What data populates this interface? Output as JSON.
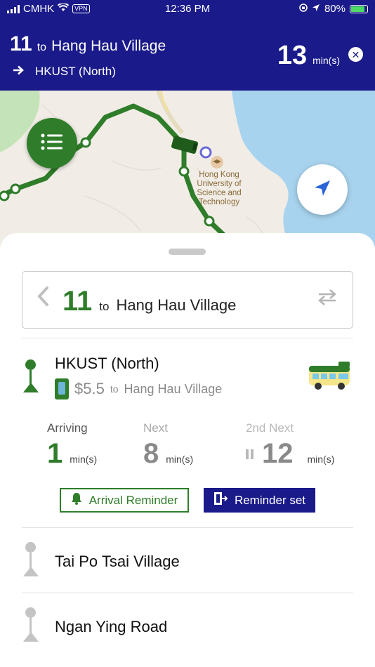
{
  "status_bar": {
    "carrier": "CMHK",
    "vpn": "VPN",
    "time": "12:36 PM",
    "battery": "80%"
  },
  "header": {
    "route_number": "11",
    "to_label": "to",
    "destination": "Hang Hau Village",
    "current_stop": "HKUST (North)",
    "eta_value": "13",
    "eta_unit": "min(s)",
    "close_icon": "close-icon"
  },
  "map": {
    "poi_label_lines": [
      "Hong Kong",
      "University of",
      "Science and",
      "Technology"
    ],
    "list_button_icon": "list-icon",
    "locate_button_icon": "navigation-arrow-icon",
    "colors": {
      "route": "#2f7d2a",
      "water": "#a8d3ee",
      "land": "#f1ede6",
      "park": "#c5e3b8"
    }
  },
  "route_selector": {
    "prev_icon": "chevron-left-icon",
    "route_number": "11",
    "to_label": "to",
    "destination": "Hang Hau Village",
    "swap_icon": "swap-direction-icon"
  },
  "current_stop": {
    "name": "HKUST (North)",
    "fare": "$5.5",
    "fare_to_label": "to",
    "fare_destination": "Hang Hau Village",
    "arrivals": [
      {
        "label": "Arriving",
        "value": "1",
        "unit": "min(s)"
      },
      {
        "label": "Next",
        "value": "8",
        "unit": "min(s)"
      },
      {
        "label": "2nd Next",
        "value": "12",
        "unit": "min(s)"
      }
    ],
    "arrival_reminder_label": "Arrival Reminder",
    "reminder_set_label": "Reminder set"
  },
  "stops": [
    {
      "name": "Tai Po Tsai Village"
    },
    {
      "name": "Ngan Ying Road"
    }
  ],
  "colors": {
    "header_bg": "#1a1a8a",
    "accent_green": "#2f7d2a",
    "muted_grey": "#9a9a9a"
  }
}
